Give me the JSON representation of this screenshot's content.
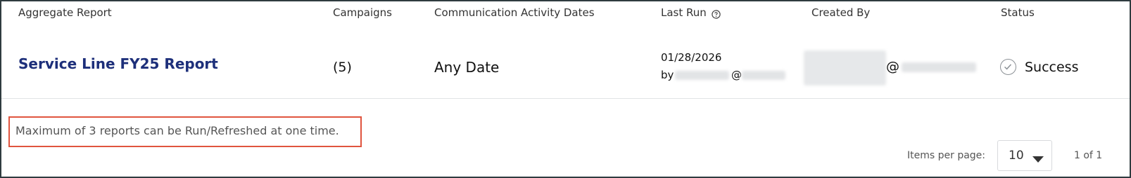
{
  "table": {
    "headers": {
      "aggregate_report": "Aggregate Report",
      "campaigns": "Campaigns",
      "communication_activity_dates": "Communication Activity Dates",
      "last_run": "Last Run",
      "created_by": "Created By",
      "status": "Status"
    },
    "rows": [
      {
        "report_name": "Service Line FY25 Report",
        "campaigns": "(5)",
        "activity_dates": "Any Date",
        "last_run_date": "01/28/2026",
        "last_run_by_prefix": "by",
        "last_run_by_at": "@",
        "created_by_at": "@",
        "status": "Success"
      }
    ]
  },
  "notice": "Maximum of 3 reports can be Run/Refreshed at one time.",
  "pagination": {
    "items_per_page_label": "Items per page:",
    "items_per_page_value": "10",
    "range": "1 of 1"
  },
  "colors": {
    "link": "#1d2f7a",
    "notice_border": "#e0543e",
    "frame": "#2f3b3f"
  },
  "icons": {
    "last_run_help": "help-circle-icon",
    "status": "check-circle-icon",
    "dropdown": "caret-down-icon"
  }
}
